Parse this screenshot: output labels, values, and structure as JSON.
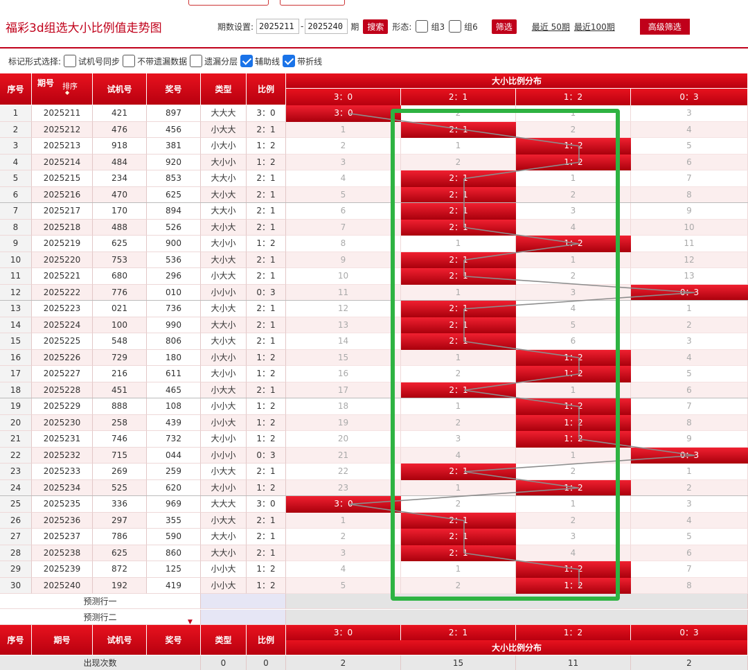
{
  "header": {
    "title": "福彩3d组选大小比例值走势图",
    "period_label": "期数设置:",
    "start": "2025211",
    "dash": "-",
    "end": "2025240",
    "qi": "期",
    "search": "搜索",
    "form_label": "形态:",
    "group3": "组3",
    "group6": "组6",
    "filter": "筛选",
    "recent50": "最近 50期",
    "recent100": "最近100期",
    "advanced": "高级筛选"
  },
  "options": {
    "label": "标记形式选择:",
    "items": [
      {
        "label": "试机号同步",
        "checked": false
      },
      {
        "label": "不带遗漏数据",
        "checked": false
      },
      {
        "label": "遗漏分层",
        "checked": false
      },
      {
        "label": "辅助线",
        "checked": true
      },
      {
        "label": "带折线",
        "checked": true
      }
    ]
  },
  "table": {
    "headers": {
      "seq": "序号",
      "period": "期号",
      "sort": "排序",
      "trial": "试机号",
      "draw": "奖号",
      "type": "类型",
      "ratio": "比例",
      "dist": "大小比例分布"
    },
    "zones": [
      "3：0",
      "2：1",
      "1：2",
      "0：3"
    ],
    "rows": [
      {
        "seq": "1",
        "period": "2025211",
        "trial": "421",
        "draw": "897",
        "type": "大大大",
        "ratio": "3：0",
        "hit": 0,
        "miss": [
          "",
          "2",
          "1",
          "3"
        ]
      },
      {
        "seq": "2",
        "period": "2025212",
        "trial": "476",
        "draw": "456",
        "type": "小大大",
        "ratio": "2：1",
        "hit": 1,
        "miss": [
          "1",
          "",
          "2",
          "4"
        ]
      },
      {
        "seq": "3",
        "period": "2025213",
        "trial": "918",
        "draw": "381",
        "type": "小大小",
        "ratio": "1：2",
        "hit": 2,
        "miss": [
          "2",
          "1",
          "",
          "5"
        ]
      },
      {
        "seq": "4",
        "period": "2025214",
        "trial": "484",
        "draw": "920",
        "type": "大小小",
        "ratio": "1：2",
        "hit": 2,
        "miss": [
          "3",
          "2",
          "",
          "6"
        ]
      },
      {
        "seq": "5",
        "period": "2025215",
        "trial": "234",
        "draw": "853",
        "type": "大大小",
        "ratio": "2：1",
        "hit": 1,
        "miss": [
          "4",
          "",
          "1",
          "7"
        ]
      },
      {
        "seq": "6",
        "period": "2025216",
        "trial": "470",
        "draw": "625",
        "type": "大小大",
        "ratio": "2：1",
        "hit": 1,
        "miss": [
          "5",
          "",
          "2",
          "8"
        ]
      },
      {
        "seq": "7",
        "period": "2025217",
        "trial": "170",
        "draw": "894",
        "type": "大大小",
        "ratio": "2：1",
        "hit": 1,
        "miss": [
          "6",
          "",
          "3",
          "9"
        ]
      },
      {
        "seq": "8",
        "period": "2025218",
        "trial": "488",
        "draw": "526",
        "type": "大小大",
        "ratio": "2：1",
        "hit": 1,
        "miss": [
          "7",
          "",
          "4",
          "10"
        ]
      },
      {
        "seq": "9",
        "period": "2025219",
        "trial": "625",
        "draw": "900",
        "type": "大小小",
        "ratio": "1：2",
        "hit": 2,
        "miss": [
          "8",
          "1",
          "",
          "11"
        ]
      },
      {
        "seq": "10",
        "period": "2025220",
        "trial": "753",
        "draw": "536",
        "type": "大小大",
        "ratio": "2：1",
        "hit": 1,
        "miss": [
          "9",
          "",
          "1",
          "12"
        ]
      },
      {
        "seq": "11",
        "period": "2025221",
        "trial": "680",
        "draw": "296",
        "type": "小大大",
        "ratio": "2：1",
        "hit": 1,
        "miss": [
          "10",
          "",
          "2",
          "13"
        ]
      },
      {
        "seq": "12",
        "period": "2025222",
        "trial": "776",
        "draw": "010",
        "type": "小小小",
        "ratio": "0：3",
        "hit": 3,
        "miss": [
          "11",
          "1",
          "3",
          ""
        ]
      },
      {
        "seq": "13",
        "period": "2025223",
        "trial": "021",
        "draw": "736",
        "type": "大小大",
        "ratio": "2：1",
        "hit": 1,
        "miss": [
          "12",
          "",
          "4",
          "1"
        ]
      },
      {
        "seq": "14",
        "period": "2025224",
        "trial": "100",
        "draw": "990",
        "type": "大大小",
        "ratio": "2：1",
        "hit": 1,
        "miss": [
          "13",
          "",
          "5",
          "2"
        ]
      },
      {
        "seq": "15",
        "period": "2025225",
        "trial": "548",
        "draw": "806",
        "type": "大小大",
        "ratio": "2：1",
        "hit": 1,
        "miss": [
          "14",
          "",
          "6",
          "3"
        ]
      },
      {
        "seq": "16",
        "period": "2025226",
        "trial": "729",
        "draw": "180",
        "type": "小大小",
        "ratio": "1：2",
        "hit": 2,
        "miss": [
          "15",
          "1",
          "",
          "4"
        ]
      },
      {
        "seq": "17",
        "period": "2025227",
        "trial": "216",
        "draw": "611",
        "type": "大小小",
        "ratio": "1：2",
        "hit": 2,
        "miss": [
          "16",
          "2",
          "",
          "5"
        ]
      },
      {
        "seq": "18",
        "period": "2025228",
        "trial": "451",
        "draw": "465",
        "type": "小大大",
        "ratio": "2：1",
        "hit": 1,
        "miss": [
          "17",
          "",
          "1",
          "6"
        ]
      },
      {
        "seq": "19",
        "period": "2025229",
        "trial": "888",
        "draw": "108",
        "type": "小小大",
        "ratio": "1：2",
        "hit": 2,
        "miss": [
          "18",
          "1",
          "",
          "7"
        ]
      },
      {
        "seq": "20",
        "period": "2025230",
        "trial": "258",
        "draw": "439",
        "type": "小小大",
        "ratio": "1：2",
        "hit": 2,
        "miss": [
          "19",
          "2",
          "",
          "8"
        ]
      },
      {
        "seq": "21",
        "period": "2025231",
        "trial": "746",
        "draw": "732",
        "type": "大小小",
        "ratio": "1：2",
        "hit": 2,
        "miss": [
          "20",
          "3",
          "",
          "9"
        ]
      },
      {
        "seq": "22",
        "period": "2025232",
        "trial": "715",
        "draw": "044",
        "type": "小小小",
        "ratio": "0：3",
        "hit": 3,
        "miss": [
          "21",
          "4",
          "1",
          ""
        ]
      },
      {
        "seq": "23",
        "period": "2025233",
        "trial": "269",
        "draw": "259",
        "type": "小大大",
        "ratio": "2：1",
        "hit": 1,
        "miss": [
          "22",
          "",
          "2",
          "1"
        ]
      },
      {
        "seq": "24",
        "period": "2025234",
        "trial": "525",
        "draw": "620",
        "type": "大小小",
        "ratio": "1：2",
        "hit": 2,
        "miss": [
          "23",
          "1",
          "",
          "2"
        ]
      },
      {
        "seq": "25",
        "period": "2025235",
        "trial": "336",
        "draw": "969",
        "type": "大大大",
        "ratio": "3：0",
        "hit": 0,
        "miss": [
          "",
          "2",
          "1",
          "3"
        ]
      },
      {
        "seq": "26",
        "period": "2025236",
        "trial": "297",
        "draw": "355",
        "type": "小大大",
        "ratio": "2：1",
        "hit": 1,
        "miss": [
          "1",
          "",
          "2",
          "4"
        ]
      },
      {
        "seq": "27",
        "period": "2025237",
        "trial": "786",
        "draw": "590",
        "type": "大大小",
        "ratio": "2：1",
        "hit": 1,
        "miss": [
          "2",
          "",
          "3",
          "5"
        ]
      },
      {
        "seq": "28",
        "period": "2025238",
        "trial": "625",
        "draw": "860",
        "type": "大大小",
        "ratio": "2：1",
        "hit": 1,
        "miss": [
          "3",
          "",
          "4",
          "6"
        ]
      },
      {
        "seq": "29",
        "period": "2025239",
        "trial": "872",
        "draw": "125",
        "type": "小小大",
        "ratio": "1：2",
        "hit": 2,
        "miss": [
          "4",
          "1",
          "",
          "7"
        ]
      },
      {
        "seq": "30",
        "period": "2025240",
        "trial": "192",
        "draw": "419",
        "type": "小小大",
        "ratio": "1：2",
        "hit": 2,
        "miss": [
          "5",
          "2",
          "",
          "8"
        ]
      }
    ],
    "predict": [
      "预测行一",
      "预测行二"
    ],
    "footer": {
      "label": "出现次数",
      "type_count": "0",
      "ratio_count": "0",
      "counts": [
        "2",
        "15",
        "11",
        "2"
      ]
    }
  },
  "colors": {
    "accent": "#c0001a",
    "highlight_box": "#2eb342"
  }
}
